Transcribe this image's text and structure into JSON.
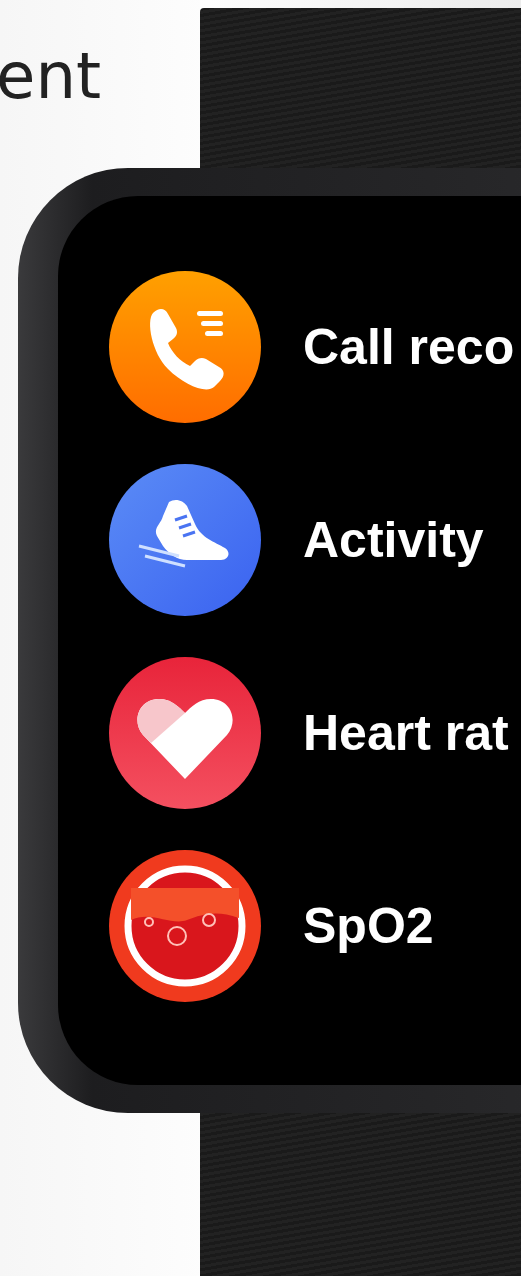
{
  "heading": "ent",
  "watch": {
    "menu": [
      {
        "kind": "call",
        "label": "Call reco"
      },
      {
        "kind": "activity",
        "label": "Activity"
      },
      {
        "kind": "heart",
        "label": "Heart rat"
      },
      {
        "kind": "spo2",
        "label": "SpO2"
      }
    ]
  }
}
